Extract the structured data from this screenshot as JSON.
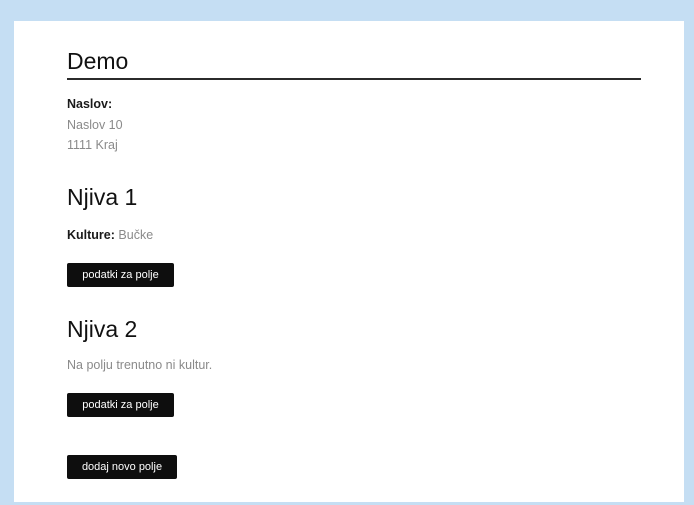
{
  "page": {
    "title": "Demo"
  },
  "address": {
    "label": "Naslov:",
    "line1": "Naslov 10",
    "line2": "1111 Kraj"
  },
  "fields": [
    {
      "name": "Njiva 1",
      "crops_label": "Kulture:",
      "crops_value": "Bučke",
      "details_button": "podatki za polje"
    },
    {
      "name": "Njiva 2",
      "no_crops_text": "Na polju trenutno ni kultur.",
      "details_button": "podatki za polje"
    }
  ],
  "actions": {
    "add_field_button": "dodaj novo polje"
  },
  "colors": {
    "background": "#c5def3",
    "card": "#ffffff",
    "button": "#0e0e0e",
    "muted_text": "#8a8a8a"
  }
}
